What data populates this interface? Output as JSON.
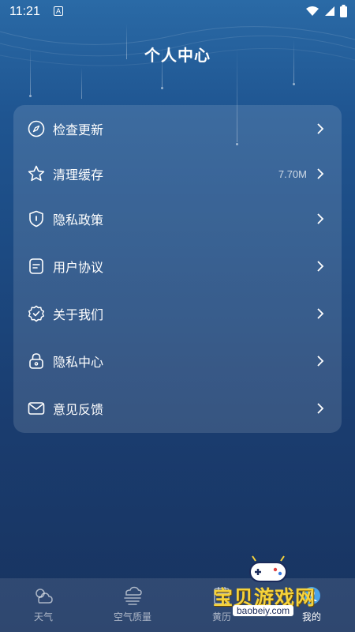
{
  "status_bar": {
    "time": "11:21",
    "notification_icon_letter": "A"
  },
  "page_title": "个人中心",
  "menu": [
    {
      "icon": "compass-icon",
      "label": "检查更新",
      "value": ""
    },
    {
      "icon": "star-icon",
      "label": "清理缓存",
      "value": "7.70M"
    },
    {
      "icon": "shield-icon",
      "label": "隐私政策",
      "value": ""
    },
    {
      "icon": "document-icon",
      "label": "用户协议",
      "value": ""
    },
    {
      "icon": "badge-check-icon",
      "label": "关于我们",
      "value": ""
    },
    {
      "icon": "lock-icon",
      "label": "隐私中心",
      "value": ""
    },
    {
      "icon": "mail-icon",
      "label": "意见反馈",
      "value": ""
    }
  ],
  "tabs": [
    {
      "icon": "weather-icon",
      "label": "天气"
    },
    {
      "icon": "air-quality-icon",
      "label": "空气质量"
    },
    {
      "icon": "almanac-icon",
      "label": "黄历"
    },
    {
      "icon": "profile-icon",
      "label": "我的"
    }
  ],
  "watermark": {
    "title": "宝贝游戏网",
    "url": "baobeiy.com"
  },
  "colors": {
    "background_top": "#2a6aa6",
    "background_bottom": "#18335f",
    "watermark_yellow": "#f5d23c"
  }
}
